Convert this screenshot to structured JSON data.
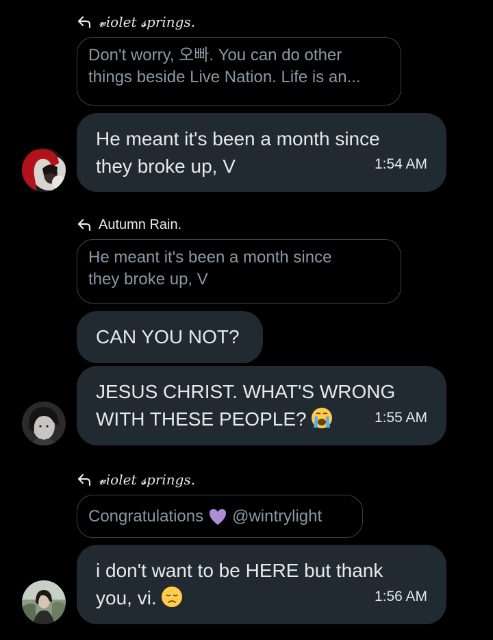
{
  "thread": [
    {
      "reply_to": "𝓿iolet 𝓼prings.",
      "quote": "Don't worry, 오빠. You can do other\nthings beside Live Nation. Life is an...",
      "messages": [
        {
          "text": "He meant it's been a month since\nthey broke up, V",
          "time": "1:54 AM"
        }
      ],
      "avatar": "user-avatar-red-hood"
    },
    {
      "reply_to": "Autumn Rain.",
      "quote": "He meant it's been a month since\nthey broke up, V",
      "messages": [
        {
          "text": "CAN YOU NOT?"
        },
        {
          "text": "JESUS CHRIST. WHAT'S WRONG\nWITH THESE PEOPLE?",
          "emoji": "loudly-crying-face",
          "time": "1:55 AM"
        }
      ],
      "avatar": "user-avatar-dark-hair"
    },
    {
      "reply_to": "𝓿iolet 𝓼prings.",
      "quote_parts": {
        "before": "Congratulations",
        "emoji": "purple-heart",
        "after": "@wintrylight"
      },
      "messages": [
        {
          "text": "i don't want to be HERE but thank\nyou, vi.",
          "emoji": "disappointed-face",
          "time": "1:56 AM"
        }
      ],
      "avatar": "user-avatar-outdoor"
    }
  ],
  "colors": {
    "background": "#000000",
    "bubble": "#222a31",
    "text": "#e7e9ea",
    "quote_text": "#8b98a5",
    "quote_border": "#3e4144"
  }
}
